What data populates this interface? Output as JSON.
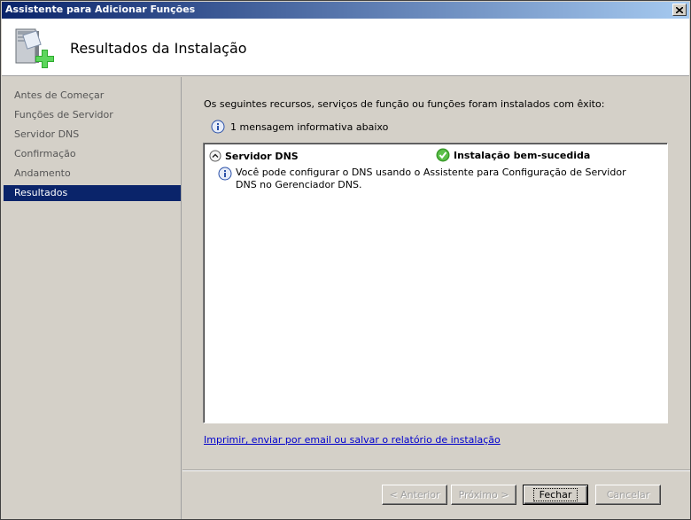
{
  "window": {
    "title": "Assistente para Adicionar Funções",
    "page_title": "Resultados da Instalação"
  },
  "sidebar": {
    "items": [
      {
        "label": "Antes de Começar",
        "active": false
      },
      {
        "label": "Funções de Servidor",
        "active": false
      },
      {
        "label": "Servidor DNS",
        "active": false
      },
      {
        "label": "Confirmação",
        "active": false
      },
      {
        "label": "Andamento",
        "active": false
      },
      {
        "label": "Resultados",
        "active": true
      }
    ]
  },
  "main": {
    "intro": "Os seguintes recursos, serviços de função ou funções foram instalados com êxito:",
    "info_count": "1 mensagem informativa abaixo",
    "results": {
      "role_name": "Servidor DNS",
      "status": "Instalação bem-sucedida",
      "message": "Você pode configurar o DNS usando o Assistente para Configuração de Servidor DNS no Gerenciador DNS."
    },
    "report_link": "Imprimir, enviar por email ou salvar o relatório de instalação"
  },
  "footer": {
    "back_label": "< Anterior",
    "next_label": "Próximo >",
    "close_label": "Fechar",
    "cancel_label": "Cancelar"
  },
  "colors": {
    "title_bar": "#0a246a",
    "selected_nav": "#0a246a",
    "link": "#0000cc",
    "success_green": "#3a9a2a",
    "info_blue": "#2a50a8"
  },
  "icons": [
    "server-role-icon",
    "close-icon",
    "info-icon",
    "collapse-icon",
    "success-check-icon"
  ]
}
